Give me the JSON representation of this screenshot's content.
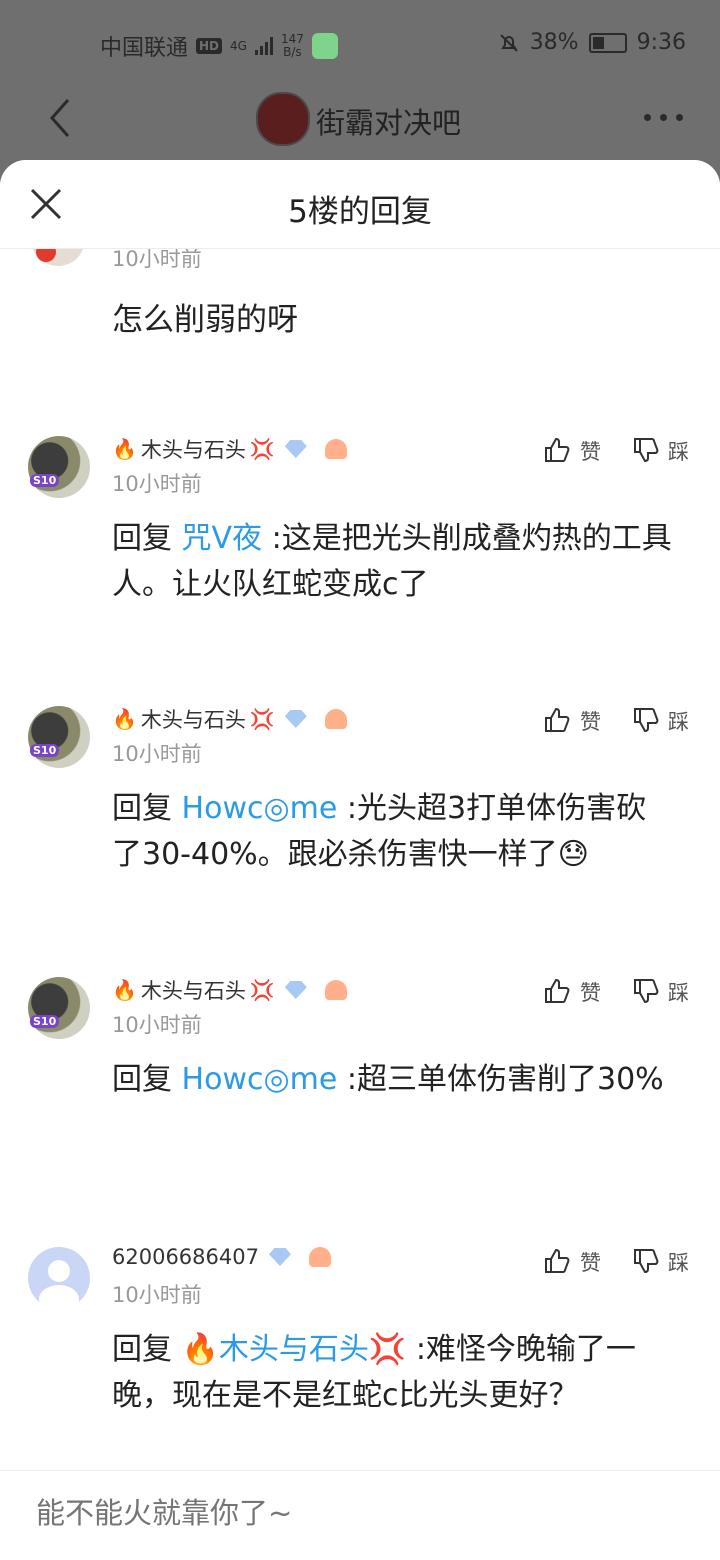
{
  "status_bar": {
    "carrier": "中国联通",
    "hd": "HD",
    "net_type": "4G",
    "speed_value": "147",
    "speed_unit": "B/s",
    "battery": "38%",
    "time": "9:36"
  },
  "forum": {
    "title": "街霸对决吧"
  },
  "sheet": {
    "title": "5楼的回复"
  },
  "partial_comment": {
    "time": "10小时前",
    "text": "怎么削弱的呀"
  },
  "comments": [
    {
      "user": "木头与石头",
      "time": "10小时前",
      "reply_prefix": "回复",
      "mention": "咒V夜",
      "text": ":这是把光头削成叠灼热的工具人。让火队红蛇变成c了",
      "like_label": "赞",
      "dislike_label": "踩"
    },
    {
      "user": "木头与石头",
      "time": "10小时前",
      "reply_prefix": "回复",
      "mention": "Howc◎me",
      "text": ":光头超3打单体伤害砍了30-40%。跟必杀伤害快一样了😓",
      "like_label": "赞",
      "dislike_label": "踩"
    },
    {
      "user": "木头与石头",
      "time": "10小时前",
      "reply_prefix": "回复",
      "mention": "Howc◎me",
      "text": ":超三单体伤害削了30%",
      "like_label": "赞",
      "dislike_label": "踩"
    },
    {
      "user": "62006686407",
      "time": "10小时前",
      "reply_prefix": "回复",
      "mention": "🔥木头与石头💢",
      "text": ":难怪今晚输了一晚，现在是不是红蛇c比光头更好？",
      "like_label": "赞",
      "dislike_label": "踩"
    }
  ],
  "badges": {
    "avatar_badge": "S10"
  },
  "input": {
    "placeholder": "能不能火就靠你了~"
  }
}
